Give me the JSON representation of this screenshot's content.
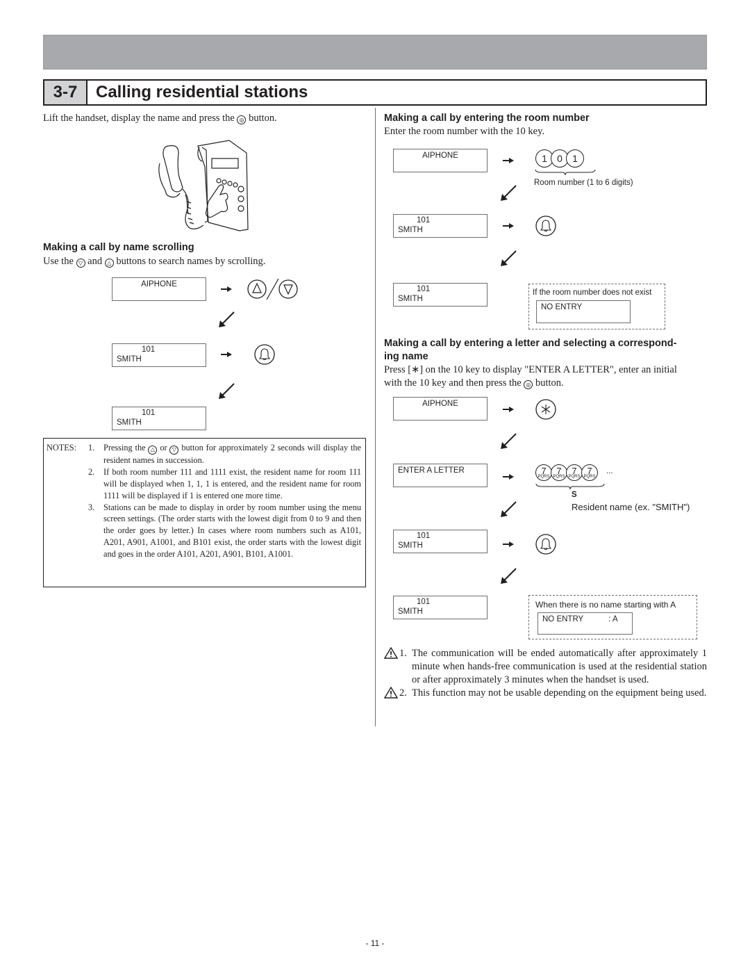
{
  "section": {
    "number": "3-7",
    "title": "Calling residential stations"
  },
  "intro": {
    "before": "Lift the handset, display the name and press the ",
    "after": " button."
  },
  "scrolling": {
    "heading": "Making a call by name scrolling",
    "desc_before": "Use the ",
    "desc_mid": " and ",
    "desc_after": " buttons to search names by scrolling.",
    "steps": [
      {
        "lcd_line1": "AIPHONE",
        "lcd_line2": "",
        "action": "up-down-buttons"
      },
      {
        "lcd_line1": "101",
        "lcd_line2": "SMITH",
        "action": "call-button"
      },
      {
        "lcd_line1": "101",
        "lcd_line2": "SMITH",
        "action": ""
      }
    ]
  },
  "notes": {
    "label": "NOTES:",
    "items": [
      {
        "num": "1.",
        "before": "Pressing the ",
        "mid": " or ",
        "after": " button for approximately 2 seconds will display the resident names in succession."
      },
      {
        "num": "2.",
        "text": "If both room number 111 and 1111 exist, the resident name for room 111 will be displayed when 1, 1, 1 is entered, and the resident name for room 1111 will be displayed if 1 is entered one more time."
      },
      {
        "num": "3.",
        "text": "Stations can be made to display in order by room number using the menu screen settings. (The order starts with the lowest digit from 0 to 9 and then the order goes by letter.) In cases where room numbers such as A101, A201, A901, A1001, and B101 exist, the order starts with the lowest digit and goes in the order A101, A201, A901, B101, A1001."
      }
    ]
  },
  "room_number": {
    "heading": "Making a call by entering the room number",
    "desc": "Enter the room number with the 10 key.",
    "digits": [
      "1",
      "0",
      "1"
    ],
    "digits_caption": "Room number (1 to 6 digits)",
    "steps": [
      {
        "lcd_line1": "AIPHONE",
        "lcd_line2": ""
      },
      {
        "lcd_line1": "101",
        "lcd_line2": "SMITH"
      },
      {
        "lcd_line1": "101",
        "lcd_line2": "SMITH"
      }
    ],
    "no_entry_caption": "If the room number does not exist",
    "no_entry_lcd": "NO ENTRY"
  },
  "letter": {
    "heading_line1": "Making a call by entering a letter and selecting a correspond-",
    "heading_line2": "ing name",
    "desc_line1": "Press [∗] on the 10 key to display \"ENTER A LETTER\", enter an initial",
    "desc_line2_before": "with the 10 key and then press the ",
    "desc_line2_after": " button.",
    "steps": [
      {
        "lcd_line1": "AIPHONE",
        "lcd_line2": ""
      },
      {
        "lcd_line1": "ENTER A LETTER",
        "lcd_line2": ""
      },
      {
        "lcd_line1": "101",
        "lcd_line2": "SMITH"
      },
      {
        "lcd_line1": "101",
        "lcd_line2": "SMITH"
      }
    ],
    "key_digit": "7",
    "key_letters": "PQRS",
    "ellipsis": "...",
    "result_letter": "S",
    "result_caption": "Resident name (ex. \"SMITH\")",
    "no_entry_caption": "When there is no name starting with A",
    "no_entry_lcd": "NO ENTRY",
    "no_entry_suffix": ": A"
  },
  "warnings": [
    {
      "num": "1.",
      "text": "The communication will be ended automatically after approximately 1 minute when hands-free communication is used at the residential station or after approximately 3 minutes when the handset is used."
    },
    {
      "num": "2.",
      "text": "This function may not be usable depending on the equipment being used."
    }
  ],
  "page_number": "- 11 -"
}
